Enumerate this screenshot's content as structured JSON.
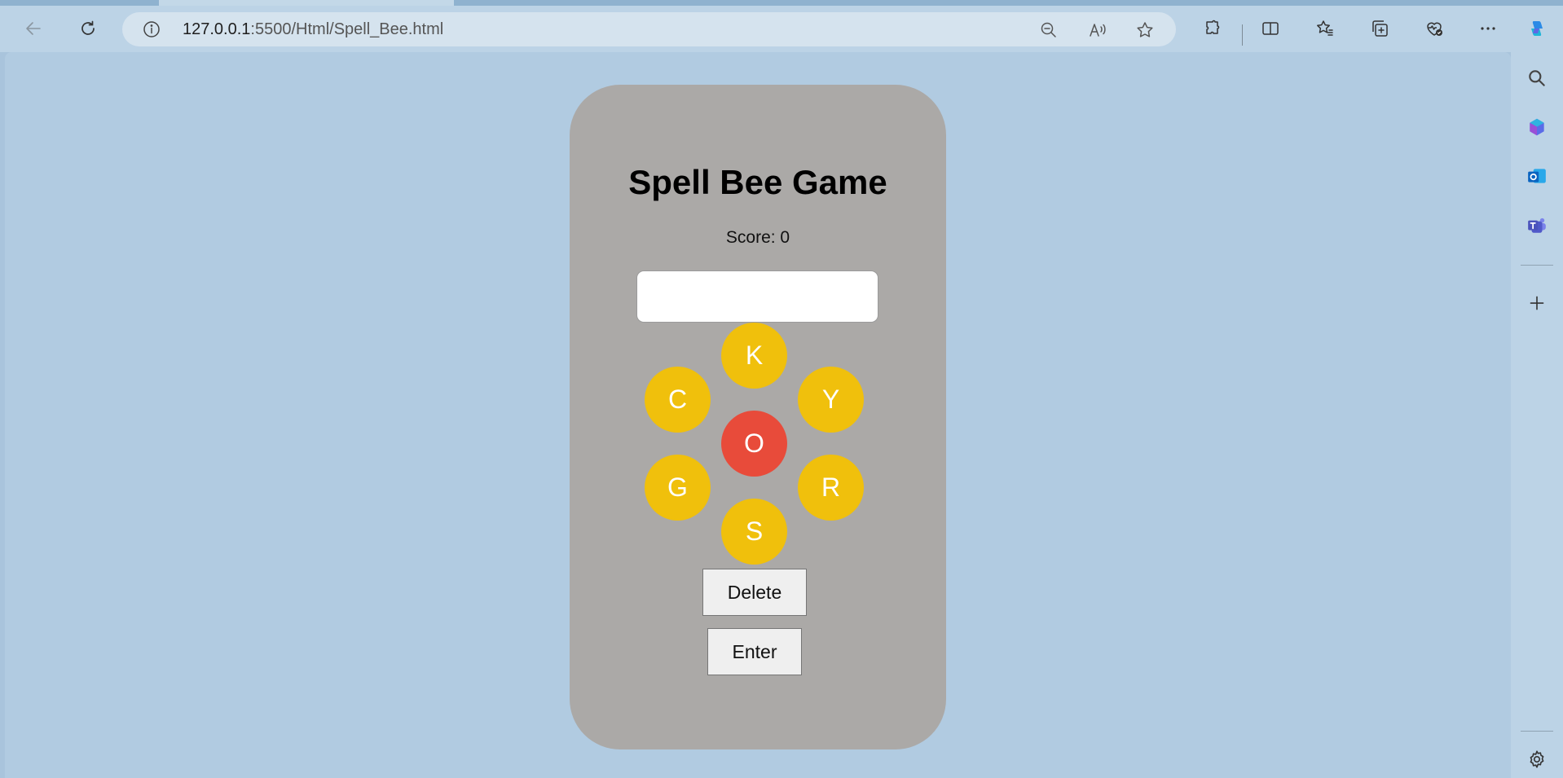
{
  "browser": {
    "url_host": "127.0.0.1",
    "url_rest": ":5500/Html/Spell_Bee.html",
    "toolbar_icons": [
      "back-arrow-icon",
      "refresh-icon",
      "zoom-out-icon",
      "read-aloud-icon",
      "favorite-star-icon",
      "extensions-icon",
      "split-screen-icon",
      "favorites-icon",
      "collections-icon",
      "browser-essentials-icon",
      "more-menu-icon",
      "copilot-icon"
    ],
    "sidebar_icons": [
      "search-icon",
      "copilot-icon",
      "outlook-icon",
      "teams-icon",
      "add-icon",
      "settings-gear-icon"
    ]
  },
  "game": {
    "title": "Spell Bee Game",
    "score_label": "Score: ",
    "score_value": "0",
    "input_value": "",
    "letters": {
      "top": "K",
      "upper_left": "C",
      "upper_right": "Y",
      "center": "O",
      "lower_left": "G",
      "lower_right": "R",
      "bottom": "S"
    },
    "delete_label": "Delete",
    "enter_label": "Enter"
  },
  "colors": {
    "outer_cell": "#f0c00c",
    "center_cell": "#e84b3a",
    "card": "#aba9a7",
    "page_background": "#b1cbe1"
  }
}
